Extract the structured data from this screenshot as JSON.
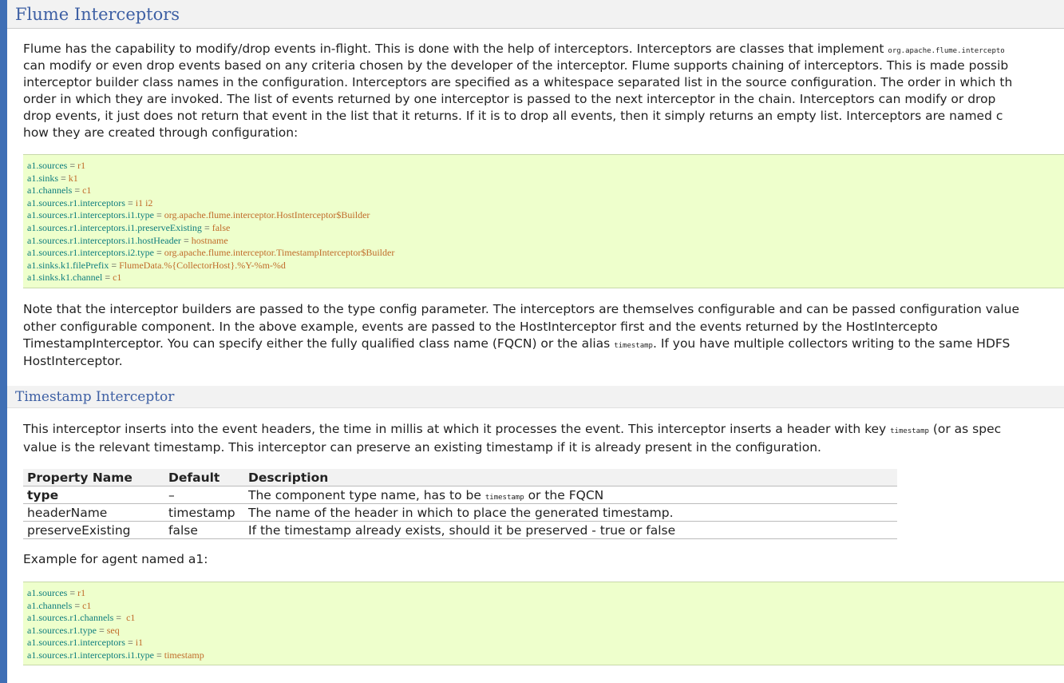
{
  "section": {
    "title": "Flume Interceptors",
    "intro_lines": [
      {
        "text": "Flume has the capability to modify/drop events in-flight. This is done with the help of interceptors. Interceptors are classes that implement ",
        "code": "org.apache.flume.intercepto"
      },
      {
        "text": "can modify or even drop events based on any criteria chosen by the developer of the interceptor. Flume supports chaining of interceptors. This is made possib"
      },
      {
        "text": "interceptor builder class names in the configuration. Interceptors are specified as a whitespace separated list in the source configuration. The order in which th"
      },
      {
        "text": "order in which they are invoked. The list of events returned by one interceptor is passed to the next interceptor in the chain. Interceptors can modify or drop"
      },
      {
        "text": "drop events, it just does not return that event in the list that it returns. If it is to drop all events, then it simply returns an empty list. Interceptors are named c"
      },
      {
        "text": "how they are created through configuration:"
      }
    ],
    "code_block_1": [
      {
        "key": "a1.sources",
        "value": "r1"
      },
      {
        "key": "a1.sinks",
        "value": "k1"
      },
      {
        "key": "a1.channels",
        "value": "c1"
      },
      {
        "key": "a1.sources.r1.interceptors",
        "value": "i1 i2"
      },
      {
        "key": "a1.sources.r1.interceptors.i1.type",
        "value": "org.apache.flume.interceptor.HostInterceptor$Builder"
      },
      {
        "key": "a1.sources.r1.interceptors.i1.preserveExisting",
        "value": "false"
      },
      {
        "key": "a1.sources.r1.interceptors.i1.hostHeader",
        "value": "hostname"
      },
      {
        "key": "a1.sources.r1.interceptors.i2.type",
        "value": "org.apache.flume.interceptor.TimestampInterceptor$Builder"
      },
      {
        "key": "a1.sinks.k1.filePrefix",
        "value": "FlumeData.%{CollectorHost}.%Y-%m-%d"
      },
      {
        "key": "a1.sinks.k1.channel",
        "value": "c1"
      }
    ],
    "note_lines": [
      {
        "text": "Note that the interceptor builders are passed to the type config parameter. The interceptors are themselves configurable and can be passed configuration value"
      },
      {
        "text": "other configurable component. In the above example, events are passed to the HostInterceptor first and the events returned by the HostIntercepto"
      },
      {
        "text": "TimestampInterceptor. You can specify either the fully qualified class name (FQCN) or the alias ",
        "code": "timestamp",
        "after": ". If you have multiple collectors writing to the same HDFS"
      },
      {
        "text": "HostInterceptor."
      }
    ]
  },
  "subsection": {
    "title": "Timestamp Interceptor",
    "intro_lines": [
      {
        "text": "This interceptor inserts into the event headers, the time in millis at which it processes the event. This interceptor inserts a header with key ",
        "code": "timestamp",
        "after": " (or as spec"
      },
      {
        "text": "value is the relevant timestamp. This interceptor can preserve an existing timestamp if it is already present in the configuration."
      }
    ],
    "table": {
      "headers": [
        "Property Name",
        "Default",
        "Description"
      ],
      "rows": [
        {
          "name": "type",
          "default": "–",
          "desc_pre": "The component type name, has to be ",
          "desc_code": "timestamp",
          "desc_post": " or the FQCN"
        },
        {
          "name": "headerName",
          "default": "timestamp",
          "desc_pre": "The name of the header in which to place the generated timestamp.",
          "desc_code": "",
          "desc_post": ""
        },
        {
          "name": "preserveExisting",
          "default": "false",
          "desc_pre": "If the timestamp already exists, should it be preserved - true or false",
          "desc_code": "",
          "desc_post": ""
        }
      ]
    },
    "example_label": "Example for agent named a1:",
    "code_block_2": [
      {
        "key": "a1.sources",
        "value": "r1"
      },
      {
        "key": "a1.channels",
        "value": "c1"
      },
      {
        "key": "a1.sources.r1.channels",
        "value": " c1"
      },
      {
        "key": "a1.sources.r1.type",
        "value": "seq"
      },
      {
        "key": "a1.sources.r1.interceptors",
        "value": "i1"
      },
      {
        "key": "a1.sources.r1.interceptors.i1.type",
        "value": "timestamp"
      }
    ]
  }
}
